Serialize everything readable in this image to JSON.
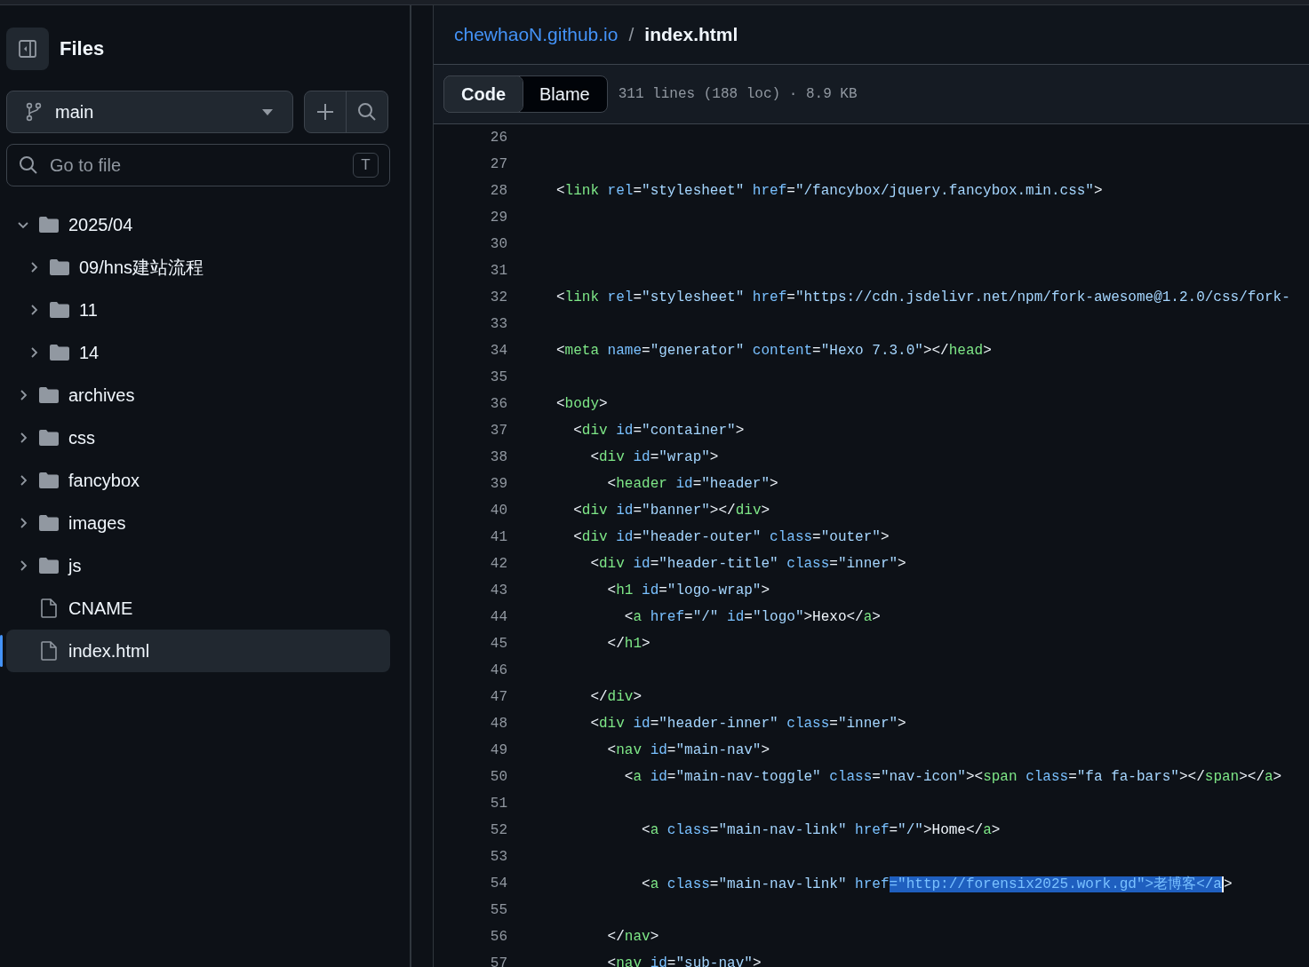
{
  "sidebar": {
    "title": "Files",
    "branch": {
      "name": "main"
    },
    "search": {
      "placeholder": "Go to file",
      "shortcut": "T"
    },
    "tree": [
      {
        "kind": "folder",
        "name": "2025/04",
        "expanded": true,
        "selected": false,
        "children": [
          {
            "kind": "folder",
            "name": "09/hns建站流程",
            "expanded": false,
            "selected": false
          },
          {
            "kind": "folder",
            "name": "11",
            "expanded": false,
            "selected": false
          },
          {
            "kind": "folder",
            "name": "14",
            "expanded": false,
            "selected": false
          }
        ]
      },
      {
        "kind": "folder",
        "name": "archives",
        "expanded": false,
        "selected": false
      },
      {
        "kind": "folder",
        "name": "css",
        "expanded": false,
        "selected": false
      },
      {
        "kind": "folder",
        "name": "fancybox",
        "expanded": false,
        "selected": false
      },
      {
        "kind": "folder",
        "name": "images",
        "expanded": false,
        "selected": false
      },
      {
        "kind": "folder",
        "name": "js",
        "expanded": false,
        "selected": false
      },
      {
        "kind": "file",
        "name": "CNAME",
        "selected": false
      },
      {
        "kind": "file",
        "name": "index.html",
        "selected": true
      }
    ]
  },
  "breadcrumb": {
    "repo": "chewhaoN.github.io",
    "separator": "/",
    "file": "index.html"
  },
  "tabs": [
    {
      "label": "Code",
      "selected": true
    },
    {
      "label": "Blame",
      "selected": false
    }
  ],
  "file_info": "311 lines (188 loc) · 8.9 KB",
  "code": {
    "lines": [
      {
        "number": "26"
      },
      {
        "number": "27"
      },
      {
        "number": "28",
        "tokens": [
          {
            "kind": "p",
            "text": "<"
          },
          {
            "kind": "tag",
            "text": "link"
          },
          {
            "kind": "attr",
            "text": " rel"
          },
          {
            "kind": "p",
            "text": "="
          },
          {
            "kind": "str",
            "text": "\"stylesheet\""
          },
          {
            "kind": "attr",
            "text": " href"
          },
          {
            "kind": "p",
            "text": "="
          },
          {
            "kind": "str",
            "text": "\"/fancybox/jquery.fancybox.min.css\""
          },
          {
            "kind": "p",
            "text": ">"
          }
        ]
      },
      {
        "number": "29"
      },
      {
        "number": "30"
      },
      {
        "number": "31"
      },
      {
        "number": "32",
        "tokens": [
          {
            "kind": "p",
            "text": "<"
          },
          {
            "kind": "tag",
            "text": "link"
          },
          {
            "kind": "attr",
            "text": " rel"
          },
          {
            "kind": "p",
            "text": "="
          },
          {
            "kind": "str",
            "text": "\"stylesheet\""
          },
          {
            "kind": "attr",
            "text": " href"
          },
          {
            "kind": "p",
            "text": "="
          },
          {
            "kind": "str",
            "text": "\"https://cdn.jsdelivr.net/npm/fork-awesome@1.2.0/css/fork-"
          }
        ]
      },
      {
        "number": "33"
      },
      {
        "number": "34",
        "tokens": [
          {
            "kind": "p",
            "text": "<"
          },
          {
            "kind": "tag",
            "text": "meta"
          },
          {
            "kind": "attr",
            "text": " name"
          },
          {
            "kind": "p",
            "text": "="
          },
          {
            "kind": "str",
            "text": "\"generator\""
          },
          {
            "kind": "attr",
            "text": " content"
          },
          {
            "kind": "p",
            "text": "="
          },
          {
            "kind": "str",
            "text": "\"Hexo 7.3.0\""
          },
          {
            "kind": "p",
            "text": "></"
          },
          {
            "kind": "tag",
            "text": "head"
          },
          {
            "kind": "p",
            "text": ">"
          }
        ]
      },
      {
        "number": "35"
      },
      {
        "number": "36",
        "tokens": [
          {
            "kind": "p",
            "text": "<"
          },
          {
            "kind": "tag",
            "text": "body"
          },
          {
            "kind": "p",
            "text": ">"
          }
        ]
      },
      {
        "number": "37",
        "tokens": [
          {
            "kind": "p",
            "text": "  <"
          },
          {
            "kind": "tag",
            "text": "div"
          },
          {
            "kind": "attr",
            "text": " id"
          },
          {
            "kind": "p",
            "text": "="
          },
          {
            "kind": "str",
            "text": "\"container\""
          },
          {
            "kind": "p",
            "text": ">"
          }
        ]
      },
      {
        "number": "38",
        "tokens": [
          {
            "kind": "p",
            "text": "    <"
          },
          {
            "kind": "tag",
            "text": "div"
          },
          {
            "kind": "attr",
            "text": " id"
          },
          {
            "kind": "p",
            "text": "="
          },
          {
            "kind": "str",
            "text": "\"wrap\""
          },
          {
            "kind": "p",
            "text": ">"
          }
        ]
      },
      {
        "number": "39",
        "tokens": [
          {
            "kind": "p",
            "text": "      <"
          },
          {
            "kind": "tag",
            "text": "header"
          },
          {
            "kind": "attr",
            "text": " id"
          },
          {
            "kind": "p",
            "text": "="
          },
          {
            "kind": "str",
            "text": "\"header\""
          },
          {
            "kind": "p",
            "text": ">"
          }
        ]
      },
      {
        "number": "40",
        "tokens": [
          {
            "kind": "p",
            "text": "  <"
          },
          {
            "kind": "tag",
            "text": "div"
          },
          {
            "kind": "attr",
            "text": " id"
          },
          {
            "kind": "p",
            "text": "="
          },
          {
            "kind": "str",
            "text": "\"banner\""
          },
          {
            "kind": "p",
            "text": "></"
          },
          {
            "kind": "tag",
            "text": "div"
          },
          {
            "kind": "p",
            "text": ">"
          }
        ]
      },
      {
        "number": "41",
        "tokens": [
          {
            "kind": "p",
            "text": "  <"
          },
          {
            "kind": "tag",
            "text": "div"
          },
          {
            "kind": "attr",
            "text": " id"
          },
          {
            "kind": "p",
            "text": "="
          },
          {
            "kind": "str",
            "text": "\"header-outer\""
          },
          {
            "kind": "attr",
            "text": " class"
          },
          {
            "kind": "p",
            "text": "="
          },
          {
            "kind": "str",
            "text": "\"outer\""
          },
          {
            "kind": "p",
            "text": ">"
          }
        ]
      },
      {
        "number": "42",
        "tokens": [
          {
            "kind": "p",
            "text": "    <"
          },
          {
            "kind": "tag",
            "text": "div"
          },
          {
            "kind": "attr",
            "text": " id"
          },
          {
            "kind": "p",
            "text": "="
          },
          {
            "kind": "str",
            "text": "\"header-title\""
          },
          {
            "kind": "attr",
            "text": " class"
          },
          {
            "kind": "p",
            "text": "="
          },
          {
            "kind": "str",
            "text": "\"inner\""
          },
          {
            "kind": "p",
            "text": ">"
          }
        ]
      },
      {
        "number": "43",
        "tokens": [
          {
            "kind": "p",
            "text": "      <"
          },
          {
            "kind": "tag",
            "text": "h1"
          },
          {
            "kind": "attr",
            "text": " id"
          },
          {
            "kind": "p",
            "text": "="
          },
          {
            "kind": "str",
            "text": "\"logo-wrap\""
          },
          {
            "kind": "p",
            "text": ">"
          }
        ]
      },
      {
        "number": "44",
        "tokens": [
          {
            "kind": "p",
            "text": "        <"
          },
          {
            "kind": "tag",
            "text": "a"
          },
          {
            "kind": "attr",
            "text": " href"
          },
          {
            "kind": "p",
            "text": "="
          },
          {
            "kind": "str",
            "text": "\"/\""
          },
          {
            "kind": "attr",
            "text": " id"
          },
          {
            "kind": "p",
            "text": "="
          },
          {
            "kind": "str",
            "text": "\"logo\""
          },
          {
            "kind": "p",
            "text": ">Hexo</"
          },
          {
            "kind": "tag",
            "text": "a"
          },
          {
            "kind": "p",
            "text": ">"
          }
        ]
      },
      {
        "number": "45",
        "tokens": [
          {
            "kind": "p",
            "text": "      </"
          },
          {
            "kind": "tag",
            "text": "h1"
          },
          {
            "kind": "p",
            "text": ">"
          }
        ]
      },
      {
        "number": "46"
      },
      {
        "number": "47",
        "tokens": [
          {
            "kind": "p",
            "text": "    </"
          },
          {
            "kind": "tag",
            "text": "div"
          },
          {
            "kind": "p",
            "text": ">"
          }
        ]
      },
      {
        "number": "48",
        "tokens": [
          {
            "kind": "p",
            "text": "    <"
          },
          {
            "kind": "tag",
            "text": "div"
          },
          {
            "kind": "attr",
            "text": " id"
          },
          {
            "kind": "p",
            "text": "="
          },
          {
            "kind": "str",
            "text": "\"header-inner\""
          },
          {
            "kind": "attr",
            "text": " class"
          },
          {
            "kind": "p",
            "text": "="
          },
          {
            "kind": "str",
            "text": "\"inner\""
          },
          {
            "kind": "p",
            "text": ">"
          }
        ]
      },
      {
        "number": "49",
        "tokens": [
          {
            "kind": "p",
            "text": "      <"
          },
          {
            "kind": "tag",
            "text": "nav"
          },
          {
            "kind": "attr",
            "text": " id"
          },
          {
            "kind": "p",
            "text": "="
          },
          {
            "kind": "str",
            "text": "\"main-nav\""
          },
          {
            "kind": "p",
            "text": ">"
          }
        ]
      },
      {
        "number": "50",
        "tokens": [
          {
            "kind": "p",
            "text": "        <"
          },
          {
            "kind": "tag",
            "text": "a"
          },
          {
            "kind": "attr",
            "text": " id"
          },
          {
            "kind": "p",
            "text": "="
          },
          {
            "kind": "str",
            "text": "\"main-nav-toggle\""
          },
          {
            "kind": "attr",
            "text": " class"
          },
          {
            "kind": "p",
            "text": "="
          },
          {
            "kind": "str",
            "text": "\"nav-icon\""
          },
          {
            "kind": "p",
            "text": "><"
          },
          {
            "kind": "tag",
            "text": "span"
          },
          {
            "kind": "attr",
            "text": " class"
          },
          {
            "kind": "p",
            "text": "="
          },
          {
            "kind": "str",
            "text": "\"fa fa-bars\""
          },
          {
            "kind": "p",
            "text": "></"
          },
          {
            "kind": "tag",
            "text": "span"
          },
          {
            "kind": "p",
            "text": "></"
          },
          {
            "kind": "tag",
            "text": "a"
          },
          {
            "kind": "p",
            "text": ">"
          }
        ]
      },
      {
        "number": "51"
      },
      {
        "number": "52",
        "tokens": [
          {
            "kind": "p",
            "text": "          <"
          },
          {
            "kind": "tag",
            "text": "a"
          },
          {
            "kind": "attr",
            "text": " class"
          },
          {
            "kind": "p",
            "text": "="
          },
          {
            "kind": "str",
            "text": "\"main-nav-link\""
          },
          {
            "kind": "attr",
            "text": " href"
          },
          {
            "kind": "p",
            "text": "="
          },
          {
            "kind": "str",
            "text": "\"/\""
          },
          {
            "kind": "p",
            "text": ">Home</"
          },
          {
            "kind": "tag",
            "text": "a"
          },
          {
            "kind": "p",
            "text": ">"
          }
        ]
      },
      {
        "number": "53"
      },
      {
        "number": "54",
        "tokens": [
          {
            "kind": "p",
            "text": "          <"
          },
          {
            "kind": "tag",
            "text": "a"
          },
          {
            "kind": "attr",
            "text": " class"
          },
          {
            "kind": "p",
            "text": "="
          },
          {
            "kind": "str",
            "text": "\"main-nav-link\""
          },
          {
            "kind": "attr",
            "text": " href"
          },
          {
            "kind": "p",
            "text": "=\"http://forensix2025.work.gd\">老博客</a",
            "selected": true
          },
          {
            "kind": "p",
            "text": ">"
          }
        ]
      },
      {
        "number": "55"
      },
      {
        "number": "56",
        "tokens": [
          {
            "kind": "p",
            "text": "      </"
          },
          {
            "kind": "tag",
            "text": "nav"
          },
          {
            "kind": "p",
            "text": ">"
          }
        ]
      },
      {
        "number": "57",
        "tokens": [
          {
            "kind": "p",
            "text": "      <"
          },
          {
            "kind": "tag",
            "text": "nav"
          },
          {
            "kind": "attr",
            "text": " id"
          },
          {
            "kind": "p",
            "text": "="
          },
          {
            "kind": "str",
            "text": "\"sub-nav\""
          },
          {
            "kind": "p",
            "text": ">"
          }
        ]
      }
    ]
  }
}
